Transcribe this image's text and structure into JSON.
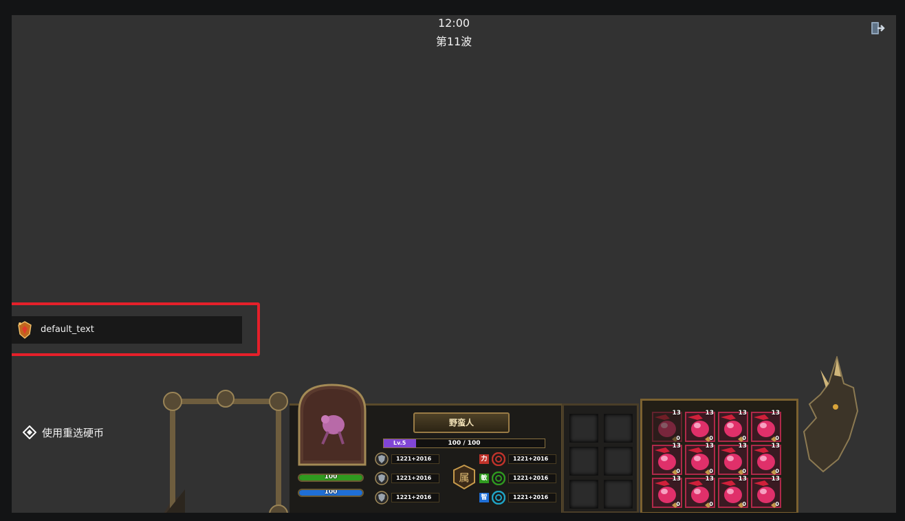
{
  "hud": {
    "clock": "12:00",
    "wave": "第11波"
  },
  "notification": {
    "text": "default_text",
    "icon": "shield-emblem-icon"
  },
  "reroll": {
    "label": "使用重选硬币",
    "icon": "diamond-icon"
  },
  "hero": {
    "name": "野蛮人",
    "level": "Lv.5",
    "exp": "100 / 100",
    "exp_fraction": 0.2,
    "hp": "100",
    "hp_fraction": 1.0,
    "mp": "100",
    "mp_fraction": 1.0,
    "class_glyph": "属",
    "defense_stats": [
      "1221+2016",
      "1221+2016",
      "1221+2016"
    ],
    "attr_tags": [
      "力",
      "敏",
      "智"
    ],
    "attr_stats": [
      "1221+2016",
      "1221+2016",
      "1221+2016"
    ]
  },
  "inventory": {
    "rows": 3,
    "cols": 4,
    "items": [
      {
        "count": "13",
        "sub": "0"
      },
      {
        "count": "13",
        "sub": "0"
      },
      {
        "count": "13",
        "sub": "0"
      },
      {
        "count": "13",
        "sub": "0"
      },
      {
        "count": "13",
        "sub": "0"
      },
      {
        "count": "13",
        "sub": "0"
      },
      {
        "count": "13",
        "sub": "0"
      },
      {
        "count": "13",
        "sub": "0"
      },
      {
        "count": "13",
        "sub": "0"
      },
      {
        "count": "13",
        "sub": "0"
      },
      {
        "count": "13",
        "sub": "0"
      },
      {
        "count": "13",
        "sub": "0"
      }
    ]
  },
  "colors": {
    "hp": "#2f9a1f",
    "mp": "#1f6fd6",
    "exp": "#8045d6",
    "alert_border": "#e5202a",
    "gem": "#e0306a"
  }
}
